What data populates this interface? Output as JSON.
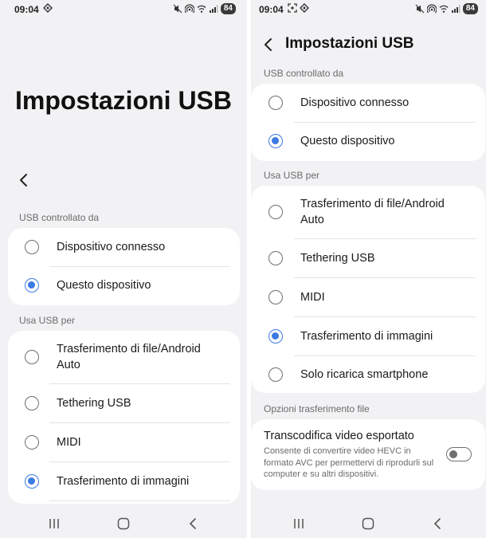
{
  "left_screen": {
    "status": {
      "time": "09:04",
      "battery": "84"
    },
    "title": "Impostazioni USB",
    "usb_controlled_label": "USB controllato da",
    "usb_controlled_options": [
      {
        "label": "Dispositivo connesso",
        "selected": false
      },
      {
        "label": "Questo dispositivo",
        "selected": true
      }
    ],
    "use_usb_label": "Usa USB per",
    "use_usb_options": [
      {
        "label": "Trasferimento di file/Android Auto",
        "selected": false
      },
      {
        "label": "Tethering USB",
        "selected": false
      },
      {
        "label": "MIDI",
        "selected": false
      },
      {
        "label": "Trasferimento di immagini",
        "selected": true
      }
    ]
  },
  "right_screen": {
    "status": {
      "time": "09:04",
      "battery": "84"
    },
    "title": "Impostazioni USB",
    "usb_controlled_label": "USB controllato da",
    "usb_controlled_options": [
      {
        "label": "Dispositivo connesso",
        "selected": false
      },
      {
        "label": "Questo dispositivo",
        "selected": true
      }
    ],
    "use_usb_label": "Usa USB per",
    "use_usb_options": [
      {
        "label": "Trasferimento di file/Android Auto",
        "selected": false
      },
      {
        "label": "Tethering USB",
        "selected": false
      },
      {
        "label": "MIDI",
        "selected": false
      },
      {
        "label": "Trasferimento di immagini",
        "selected": true
      },
      {
        "label": "Solo ricarica smartphone",
        "selected": false
      }
    ],
    "file_transfer_options_label": "Opzioni trasferimento file",
    "transcode": {
      "title": "Transcodifica video esportato",
      "description": "Consente di convertire video HEVC in formato AVC per permettervi di riprodurli sul computer e su altri dispositivi.",
      "enabled": false
    }
  },
  "colors": {
    "accent": "#3c7be3",
    "background": "#f2f2f4",
    "card": "#ffffff"
  }
}
